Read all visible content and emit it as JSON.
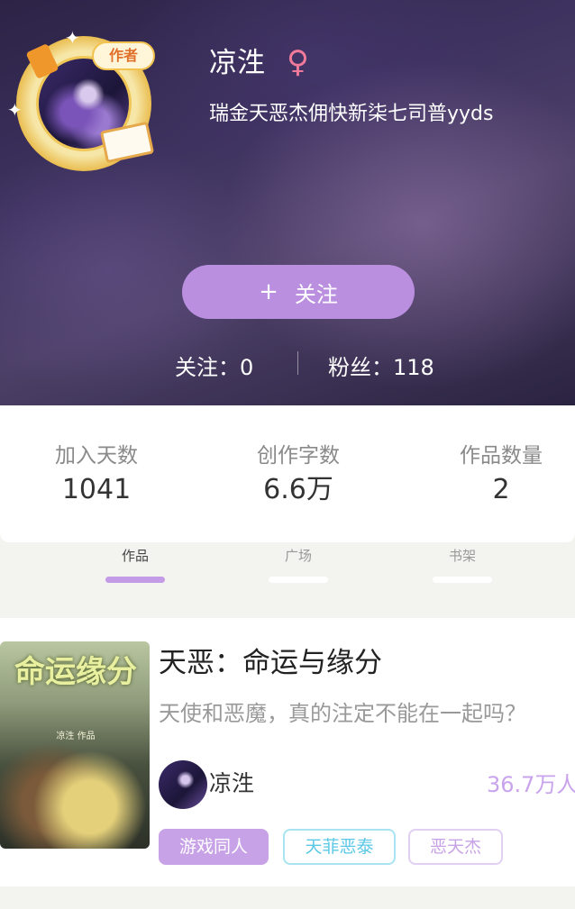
{
  "profile": {
    "username": "凉泩",
    "gender_symbol": "♀",
    "signature": "瑞金天恶杰佣快新柒七司普yyds",
    "author_badge": "作者",
    "follow_button": {
      "plus": "+",
      "label": "关注"
    },
    "following": "关注：0",
    "fans": "粉丝：118"
  },
  "stats": [
    {
      "label": "加入天数",
      "value": "1041"
    },
    {
      "label": "创作字数",
      "value": "6.6万"
    },
    {
      "label": "作品数量",
      "value": "2"
    }
  ],
  "tabs": [
    {
      "label": "作品",
      "active": true
    },
    {
      "label": "广场",
      "active": false
    },
    {
      "label": "书架",
      "active": false
    }
  ],
  "work": {
    "title": "天恶：命运与缘分",
    "description": "天使和恶魔，真的注定不能在一起吗？",
    "author": "凉泩",
    "views": "36.7万人",
    "cover_title": "命运缘分",
    "cover_sub": "凉泩 作品",
    "tags": [
      "游戏同人",
      "天菲恶泰",
      "恶天杰"
    ]
  },
  "colors": {
    "accent": "#bb8fe0",
    "tag_primary": "#c8a2e6",
    "tag_cyan": "#5ac8e6",
    "gender": "#f07a9a"
  }
}
